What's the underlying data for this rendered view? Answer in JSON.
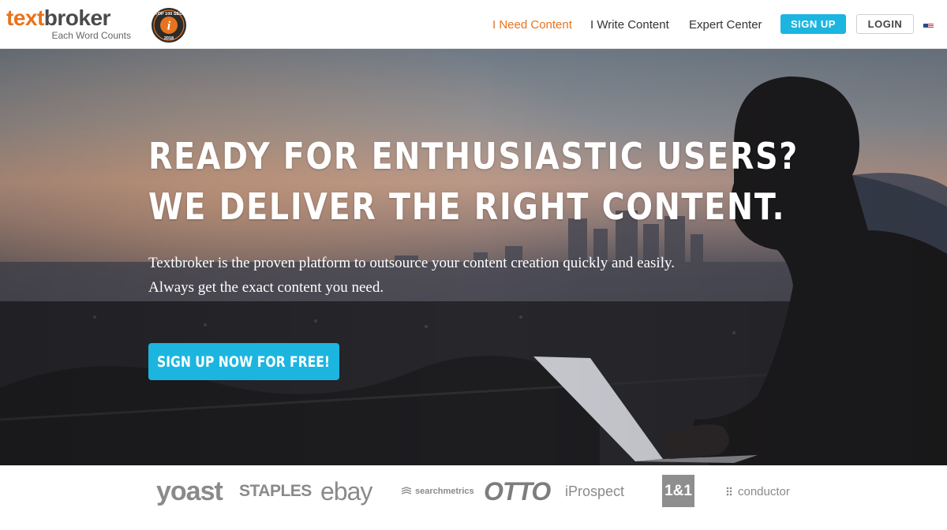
{
  "brand": {
    "logo_part1": "text",
    "logo_part2": "broker",
    "tagline": "Each Word Counts",
    "badge_text_top": "TOP 100 SEO",
    "badge_year": "2018",
    "badge_letter": "i",
    "accent_color": "#e8731d"
  },
  "nav": {
    "items": [
      {
        "label": "I Need Content",
        "active": true
      },
      {
        "label": "I Write Content",
        "active": false
      },
      {
        "label": "Expert Center",
        "active": false
      }
    ],
    "signup_label": "SIGN UP",
    "login_label": "LOGIN",
    "language_icon": "us-flag-icon"
  },
  "hero": {
    "headline_line1": "READY FOR ENTHUSIASTIC USERS?",
    "headline_line2": "WE DELIVER THE RIGHT CONTENT.",
    "subtext_line1": "Textbroker is the proven platform to outsource your content creation quickly and easily.",
    "subtext_line2": "Always get the exact content you need.",
    "cta_label": "SIGN UP NOW FOR FREE!",
    "cta_color": "#1cb5e0"
  },
  "clients": {
    "logos": [
      "yoast",
      "STAPLES",
      "ebay",
      "searchmetrics",
      "OTTO",
      "iProspect",
      "1&1",
      "conductor"
    ]
  }
}
